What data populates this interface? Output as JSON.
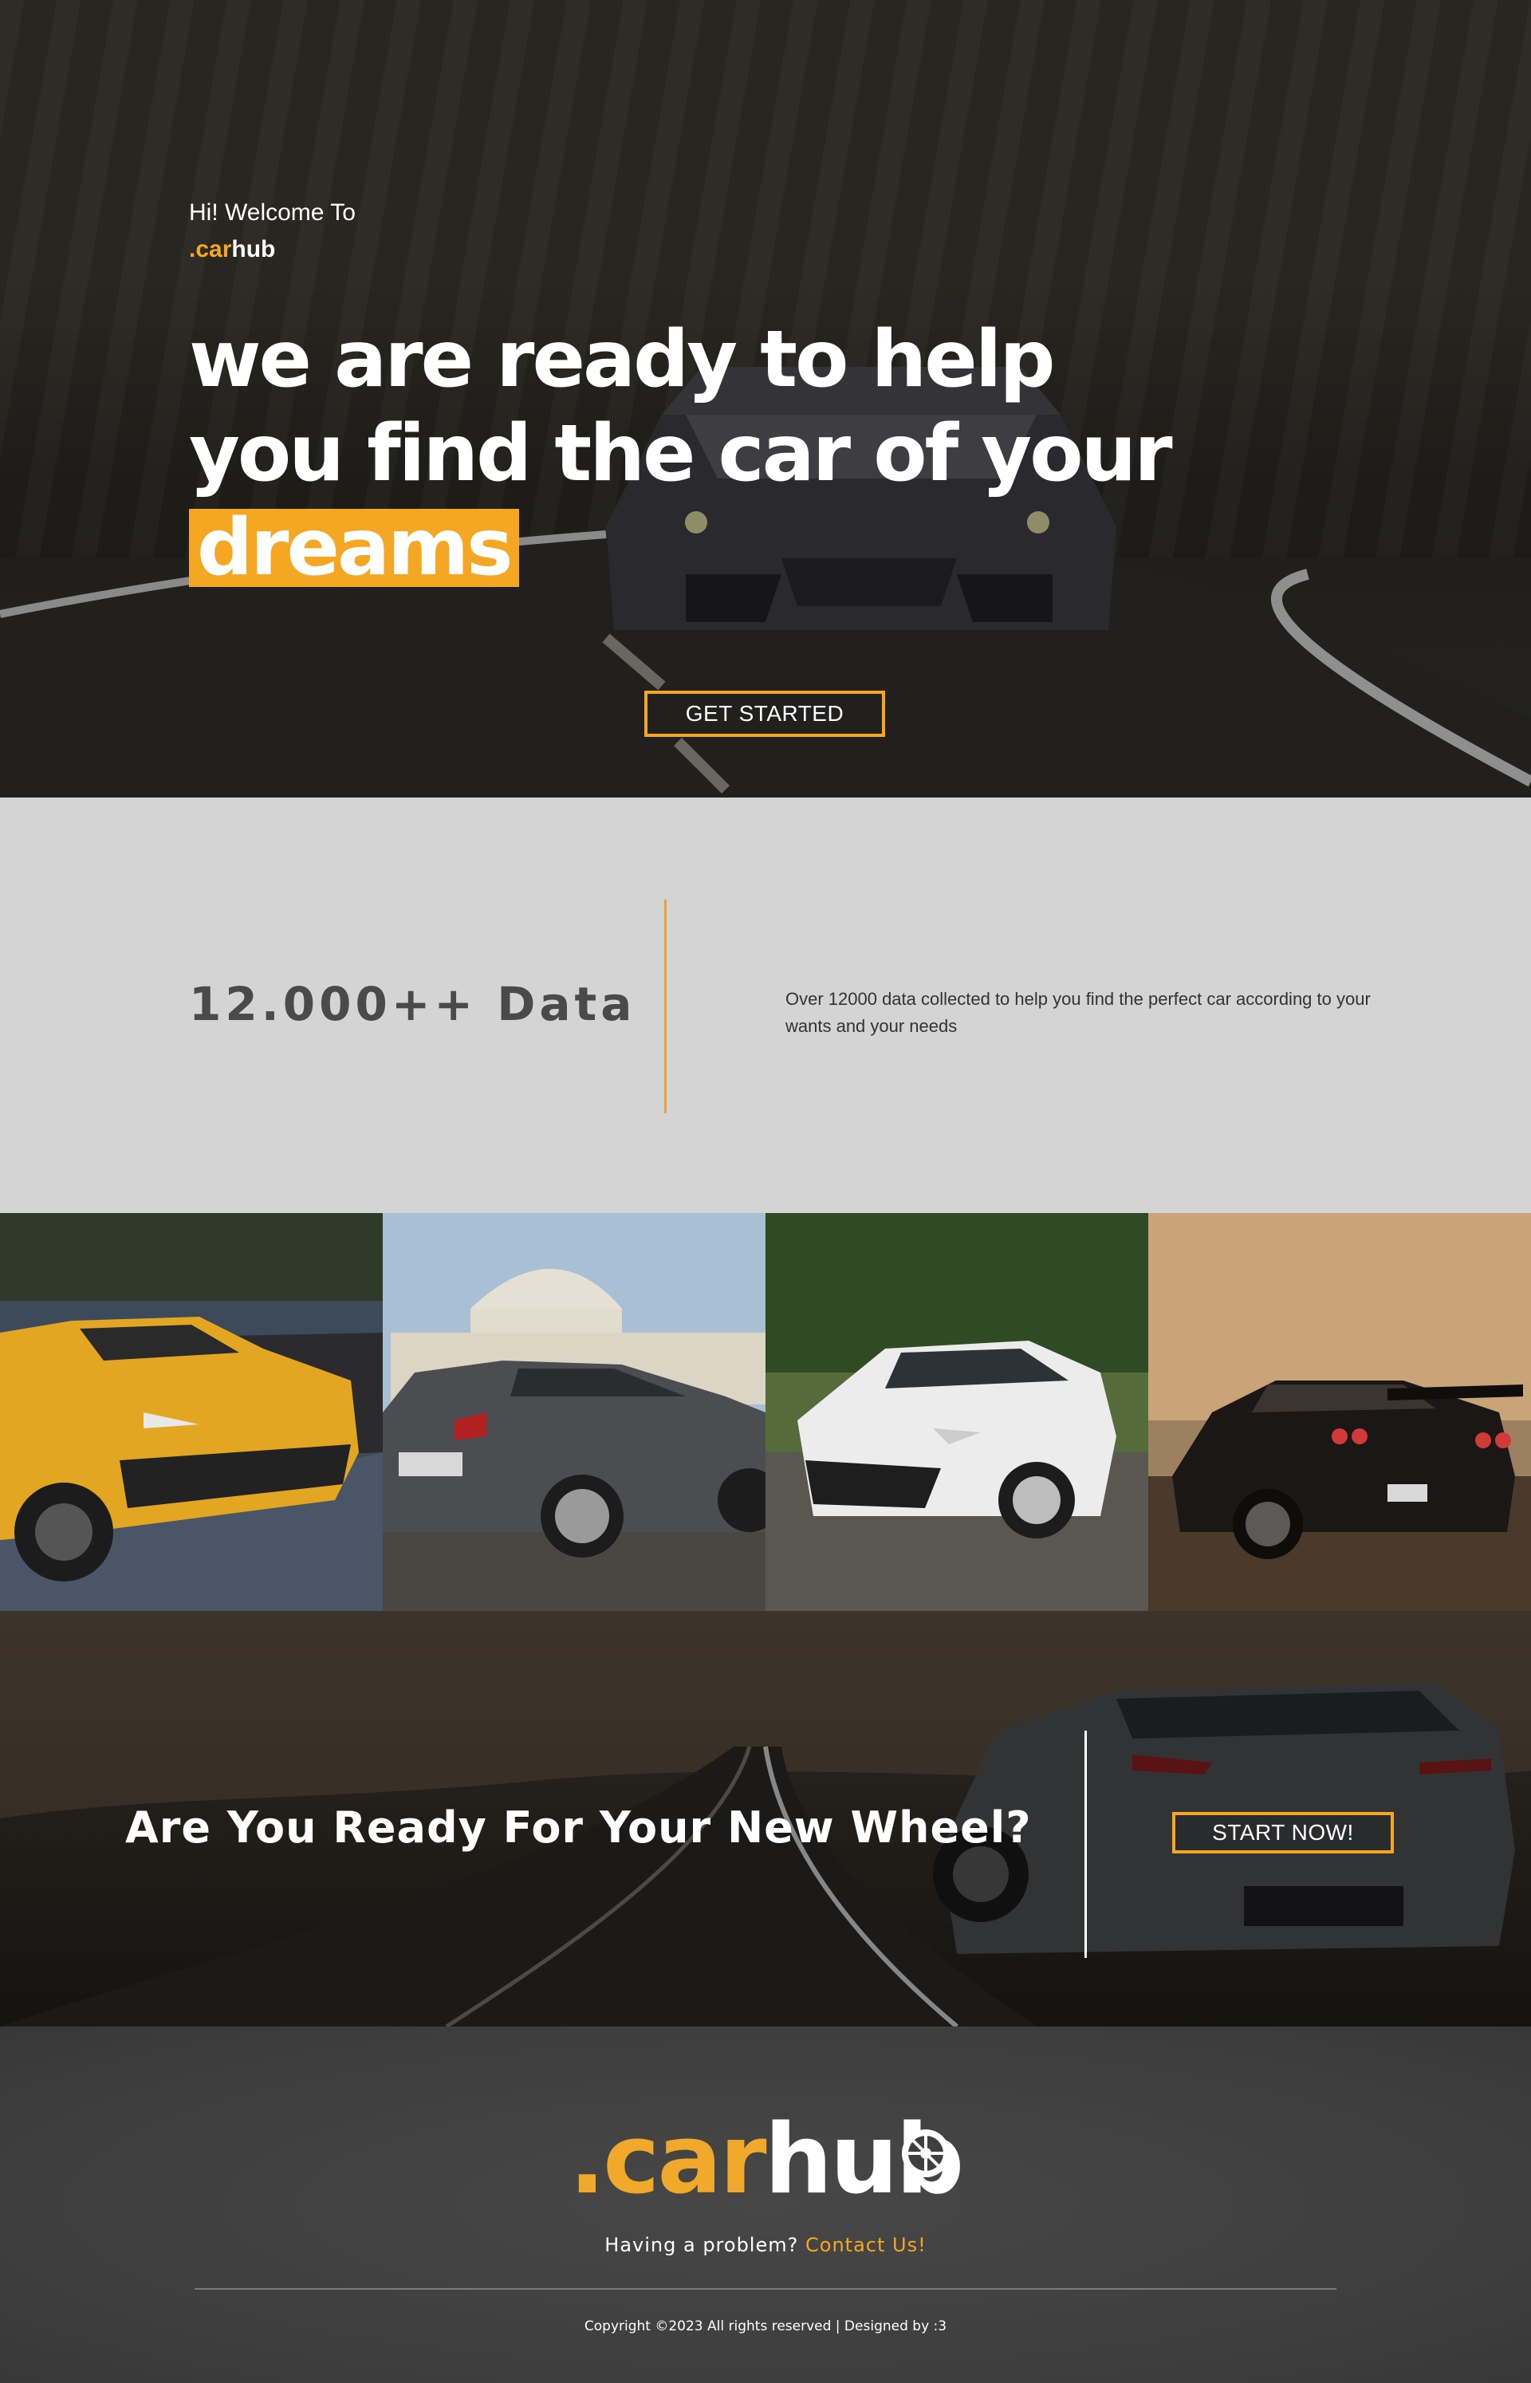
{
  "hero": {
    "welcome": "Hi! Welcome To",
    "brand": {
      "dot": ".",
      "car": "car",
      "hub": "hub"
    },
    "headline_line1": "we are ready to help",
    "headline_line2": "you find the car of your",
    "headline_highlight": "dreams",
    "cta_label": "GET STARTED"
  },
  "stats": {
    "title": "12.000++ Data",
    "description": "Over 12000 data collected to help you find the perfect car according to your wants and your needs"
  },
  "cta": {
    "text": "Are You Ready For Your New Wheel?",
    "button_label": "START NOW!"
  },
  "footer": {
    "logo": {
      "dot": ".",
      "car": "car",
      "hub": "hub"
    },
    "help_text": "Having a problem?",
    "contact_link": "Contact Us!",
    "copyright": "Copyright ©2023 All rights reserved | Designed by :3"
  },
  "colors": {
    "accent": "#f5a623",
    "stats_bg": "#d4d4d4",
    "footer_bg": "#404040"
  },
  "icons": {
    "footer_logo_wheel": "car-wheel-icon"
  }
}
